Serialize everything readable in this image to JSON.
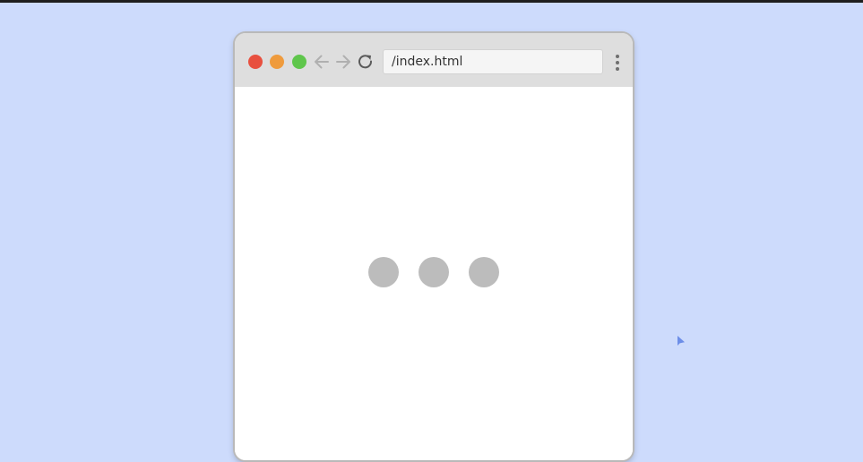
{
  "browser": {
    "url": "/index.html",
    "traffic_lights": {
      "close_color": "#e8503f",
      "minimize_color": "#ef9b3d",
      "zoom_color": "#5fc64c"
    },
    "icons": {
      "back": "arrow-left-icon",
      "forward": "arrow-right-icon",
      "reload": "reload-icon",
      "menu": "more-vertical-icon"
    }
  },
  "page": {
    "loader_dot_count": 3,
    "loader_dot_color": "#bcbcbc"
  },
  "desktop": {
    "background_color": "#cddbfc",
    "cursor_color": "#6d8ee8"
  }
}
